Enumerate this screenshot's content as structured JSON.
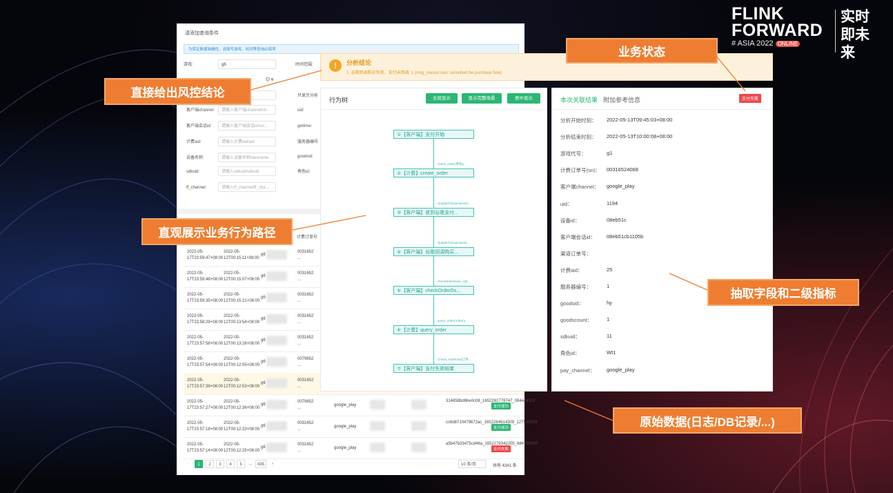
{
  "logo": {
    "line1": "FLINK",
    "line2": "FORWARD",
    "sub": "# ASIA 2022",
    "online": "ONLINE",
    "cn": "实时即未来"
  },
  "callouts": {
    "status": "业务状态",
    "conclusion": "直接给出风控结论",
    "path": "直观展示业务行为路径",
    "extract": "抽取字段和二级指标",
    "raw": "原始数据(日志/DB记录/...)"
  },
  "back": {
    "panel_title": "请添加查询条件",
    "tip": "为保证数据准确性，请填写游戏、时间等查询必填项",
    "label_game": "游戏:",
    "value_game": "g6",
    "label_time": "时间范围:",
    "labels": [
      "客户端channel:",
      "客户端会话id:",
      "计费aid:",
      "设备名称:",
      "sdkuid:",
      "ff_channel:"
    ],
    "placeholders": [
      "请输入客户端channel/ch...",
      "请输入客户端会话id/ssi...",
      "请输入计费aid/aid",
      "请输入设备名称/devname",
      "请输入sdkuid/sdkuid",
      "请输入ff_channel/ff_cha..."
    ],
    "right_labels": [
      "只显示分析",
      "uid:",
      "gettime:",
      "服务器编号",
      "goodsid:",
      "角色id:"
    ],
    "col_header": "计费订单号",
    "rows": [
      {
        "a": "2022-05-17T23:59:47+08:00",
        "b": "2022-05-12T00:15:11+08:00",
        "c": "g6",
        "d": "0031652 ...",
        "e": "",
        "tag": ""
      },
      {
        "a": "2022-05-17T23:59:48+08:00",
        "b": "2022-05-12T00:15:07+08:00",
        "c": "g6",
        "d": "0031652 ...",
        "e": "",
        "tag": ""
      },
      {
        "a": "2022-05-17T23:59:35+08:00",
        "b": "2022-05-12T00:15:21+08:00",
        "c": "g6",
        "d": "0031652 ...",
        "e": "",
        "tag": ""
      },
      {
        "a": "2022-05-17T23:58:29+08:00",
        "b": "2022-05-12T00:13:54+08:00",
        "c": "g6",
        "d": "0031652 ...",
        "e": "",
        "tag": ""
      },
      {
        "a": "2022-05-17T23:57:58+08:00",
        "b": "2022-05-12T00:13:28+08:00",
        "c": "g6",
        "d": "0031652 ...",
        "e": "",
        "tag": ""
      },
      {
        "a": "2022-05-17T23:57:54+08:00",
        "b": "2022-05-12T00:12:55+08:00",
        "c": "g6",
        "d": "0079652 ...",
        "e": "",
        "tag": ""
      },
      {
        "a": "2022-05-17T23:57:38+08:00",
        "b": "2022-05-12T00:12:53+08:00",
        "c": "g6",
        "d": "0031652 ...",
        "e": "",
        "tag": ""
      },
      {
        "a": "2022-05-17T23:57:27+08:00",
        "b": "2022-05-12T00:12:36+08:00",
        "c": "g6",
        "d": "0079652 ...",
        "e": "314858bd6be0c08_1652261778747_084444302",
        "tag": "支付成功"
      },
      {
        "a": "2022-05-17T23:57:18+08:00",
        "b": "2022-05-12T00:12:33+08:00",
        "c": "g6",
        "d": "0031652 ...",
        "e": "cc6d8710479672ac_1652264614309_127539093",
        "tag": "支付成功"
      },
      {
        "a": "2022-05-17T23:57:14+08:00",
        "b": "2022-05-12T00:12:25+08:00",
        "c": "g6",
        "d": "0031652 ...",
        "e": "a5b47b33475cd46a_1652279342205_684793690",
        "tag": "支付失败"
      }
    ],
    "row_channel": "google_play",
    "pager": {
      "pages": [
        "1",
        "2",
        "3",
        "4",
        "5",
        "...",
        "435"
      ],
      "per_page": "10 条/页",
      "total": "共有 4341 条"
    }
  },
  "alert": {
    "title": "分析结论",
    "message": "1. 谷歌回调购买失败，支付未回调: 1 (msg_reason:user cancelled the purchase flow)"
  },
  "tree": {
    "title": "行为树",
    "buttons": [
      "全屏显示",
      "显示完整场景",
      "居中显示"
    ],
    "nodes": [
      "①【客户端】支付开始",
      "②【计费】create_order",
      "③【客户端】收到谷歌支付...",
      "④【客户端】谷歌回调购买...",
      "⑤【客户端】checkOrderDo...",
      "⑥【计费】query_order",
      "⑦【客户端】支付失败结束"
    ],
    "edges": [
      "check_order(单件g...",
      "UpdateTransactionSO...",
      "UpdateTransactionSt...",
      "checkOrderDone_call...",
      "query_order(order(1...",
      "Check_endOrder(订单..."
    ]
  },
  "info": {
    "title": "本次关联结果",
    "subtitle": "附加参考信息",
    "status": "支付失败",
    "fields": [
      {
        "k": "分析开始时刻：",
        "v": "2022-05-13T09:45:03+08:00"
      },
      {
        "k": "分析结束时刻：",
        "v": "2022-05-13T10:00:08+08:00"
      },
      {
        "k": "游戏代号：",
        "v": "g1"
      },
      {
        "k": "计费订单号(sn)：",
        "v": "00316524068"
      },
      {
        "k": "客户端channel：",
        "v": "google_play"
      },
      {
        "k": "uid：",
        "v": "1194"
      },
      {
        "k": "设备id：",
        "v": "08eb51c"
      },
      {
        "k": "客户端会话id：",
        "v": "08eb51cb1105b"
      },
      {
        "k": "渠道订单号：",
        "v": ""
      },
      {
        "k": "计费aid：",
        "v": "25"
      },
      {
        "k": "服务器编号：",
        "v": "1"
      },
      {
        "k": "goodsid：",
        "v": "hy"
      },
      {
        "k": "goodscount：",
        "v": "1"
      },
      {
        "k": "sdkuid：",
        "v": "11"
      },
      {
        "k": "角色id：",
        "v": "Wt1"
      },
      {
        "k": "pay_channel：",
        "v": "google_play"
      }
    ]
  },
  "colors": {
    "accent": "#ee7d31",
    "green": "#2bb673",
    "red": "#f0474a",
    "teal": "#3ec4b3",
    "warn": "#e39a1d"
  }
}
